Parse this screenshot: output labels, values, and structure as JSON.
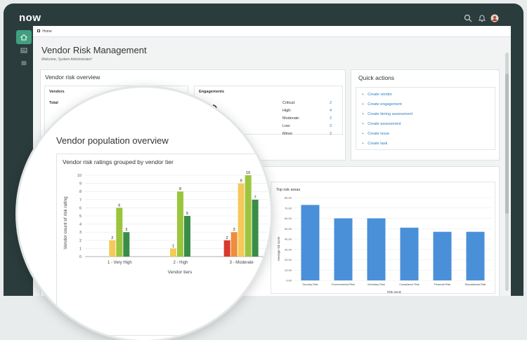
{
  "app": {
    "logo": "now"
  },
  "breadcrumb": {
    "label": "Home"
  },
  "page": {
    "title": "Vendor Risk Management",
    "subtitle": "Welcome, System Administrator!"
  },
  "overview": {
    "title": "Vendor risk overview",
    "vendors": {
      "title": "Vendors",
      "total_label": "Total"
    },
    "engagements": {
      "title": "Engagements",
      "rows": [
        {
          "label": "Critical:",
          "value": "2"
        },
        {
          "label": "High:",
          "value": "4"
        },
        {
          "label": "Moderate:",
          "value": "2"
        },
        {
          "label": "Low:",
          "value": "3"
        },
        {
          "label": "Minor:",
          "value": "2"
        }
      ]
    }
  },
  "quick_actions": {
    "title": "Quick actions",
    "items": [
      "Create vendor",
      "Create engagement",
      "Create tiering assessment",
      "Create assessment",
      "Create issue",
      "Create task"
    ]
  },
  "population": {
    "title": "Vendor population overview"
  },
  "colors": {
    "critical": "#d9382e",
    "high": "#f08c3a",
    "moderate": "#f5c95a",
    "low": "#9bc53d",
    "minor": "#3a8d47",
    "bar_blue": "#4a90d9",
    "accent": "#3fa07f",
    "link": "#2d7fc1"
  },
  "chart_data": [
    {
      "type": "bar",
      "title": "Vendor risk ratings grouped by vendor tier",
      "xlabel": "Vendor tiers",
      "ylabel": "Vendor count of risk rating",
      "ylim": [
        0,
        10
      ],
      "yticks": [
        "0",
        "1",
        "2",
        "3",
        "4",
        "5",
        "6",
        "7",
        "8",
        "9",
        "10"
      ],
      "categories": [
        "1 - Very High",
        "2 - High",
        "3 - Moderate"
      ],
      "series": [
        {
          "values": [
            0,
            0,
            2
          ],
          "color_key": "critical"
        },
        {
          "values": [
            0,
            0,
            3
          ],
          "color_key": "high"
        },
        {
          "values": [
            2,
            1,
            9
          ],
          "color_key": "moderate"
        },
        {
          "values": [
            6,
            8,
            10
          ],
          "color_key": "low"
        },
        {
          "values": [
            3,
            5,
            7
          ],
          "color_key": "minor"
        }
      ]
    },
    {
      "type": "bar",
      "title": "Top risk areas",
      "xlabel": "Risk areas",
      "ylabel": "Average risk score",
      "ylim": [
        0,
        80
      ],
      "yticks": [
        "0.00",
        "10.00",
        "20.00",
        "30.00",
        "40.00",
        "50.00",
        "60.00",
        "70.00",
        "80.00"
      ],
      "categories": [
        "Security Risk",
        "Environmental Risk",
        "Monetary Risk",
        "Compliance Risk",
        "Financial Risk",
        "Reputational Risk"
      ],
      "values": [
        73,
        60,
        60,
        51,
        47,
        47
      ]
    }
  ]
}
